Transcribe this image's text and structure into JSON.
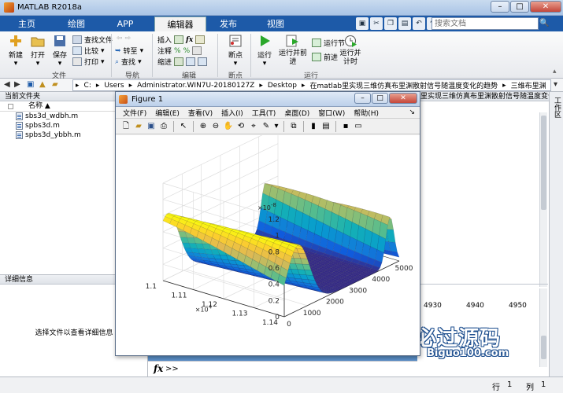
{
  "window": {
    "title": "MATLAB R2018a"
  },
  "tabs": [
    {
      "label": "主页"
    },
    {
      "label": "绘图"
    },
    {
      "label": "APP"
    },
    {
      "label": "编辑器"
    },
    {
      "label": "发布"
    },
    {
      "label": "视图"
    }
  ],
  "search": {
    "placeholder": "搜索文档"
  },
  "ribbon": {
    "file": {
      "new": "新建",
      "open": "打开",
      "save": "保存",
      "find_files": "查找文件",
      "compare": "比较",
      "print": "打印",
      "group": "文件"
    },
    "nav": {
      "goto": "转至",
      "find": "查找",
      "group": "导航"
    },
    "edit": {
      "insert": "插入",
      "comment": "注释",
      "indent": "缩进",
      "fx": "fx",
      "group": "编辑"
    },
    "breakpoints": {
      "breakpoints": "断点",
      "group": "断点"
    },
    "run": {
      "run": "运行",
      "run_advance": "运行并前进",
      "run_section": "运行节",
      "advance": "前进",
      "run_time": "运行并计时",
      "group": "运行"
    }
  },
  "address": {
    "segments": [
      "C:",
      "Users",
      "Administrator.WIN7U-20180127Z",
      "Desktop",
      "在matlab里实现三维仿真布里渊散射信号随温度变化的趋势",
      "三维布里渊"
    ]
  },
  "current_folder": {
    "title": "当前文件夹",
    "column": "名称 ▲",
    "files": [
      "sbs3d_wdbh.m",
      "spbs3d.m",
      "spbs3d_ybbh.m"
    ]
  },
  "details": {
    "title": "详细信息",
    "message": "选择文件以查看详细信息"
  },
  "right_pane": {
    "path_tail": "里实现三维仿真布里渊散射信号随温度变化的趋...",
    "values": [
      "4930",
      "4940",
      "4950"
    ]
  },
  "workspace": {
    "label": "工作区"
  },
  "command": {
    "fx": "fx",
    "prompt": ">>"
  },
  "status": {
    "row": "行",
    "row_value": "1",
    "col": "列",
    "col_value": "1"
  },
  "figure": {
    "title": "Figure 1",
    "menu": [
      "文件(F)",
      "编辑(E)",
      "查看(V)",
      "插入(I)",
      "工具(T)",
      "桌面(D)",
      "窗口(W)",
      "帮助(H)"
    ]
  },
  "chart_data": {
    "type": "surface",
    "z_exponent_label": "×10",
    "z_exponent": "-8",
    "z_ticks": [
      "0",
      "0.2",
      "0.4",
      "0.6",
      "0.8",
      "1",
      "1.2"
    ],
    "y_exponent_label": "×10",
    "y_exponent": "4",
    "y_ticks": [
      "1.1",
      "1.11",
      "1.12",
      "1.13",
      "1.14"
    ],
    "x_ticks": [
      "0",
      "1000",
      "2000",
      "3000",
      "4000",
      "5000"
    ],
    "xlim": [
      0,
      5000
    ],
    "ylim": [
      11000,
      11400
    ],
    "zlim": [
      0,
      1.2e-08
    ],
    "peaks": [
      {
        "x_center": 400,
        "x_width": 700,
        "z_max": 8e-09
      },
      {
        "x_center": 4600,
        "x_width": 250,
        "z_max": 6e-09
      }
    ],
    "colormap": "parula",
    "grid": true
  },
  "watermark": {
    "zh": "必过源码",
    "en": "Biguo100.com"
  }
}
